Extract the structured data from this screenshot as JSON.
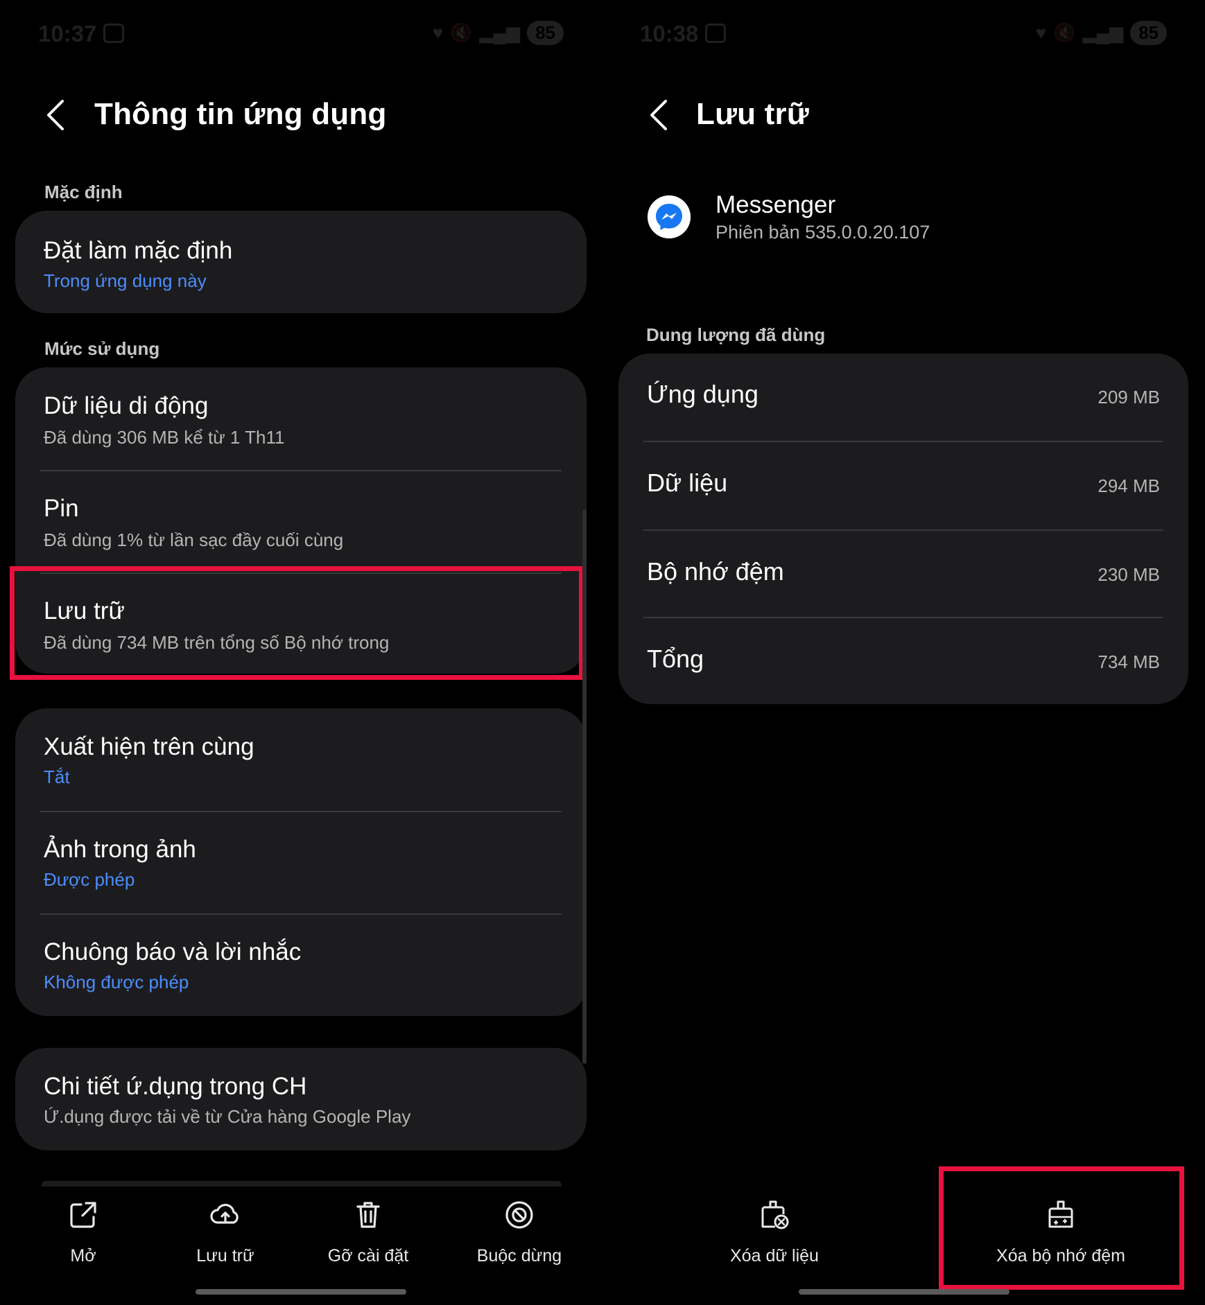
{
  "left_screen": {
    "status_bar": {
      "time": "10:37",
      "battery": "85"
    },
    "title": "Thông tin ứng dụng",
    "sections": [
      {
        "label": "Mặc định",
        "items": [
          {
            "title": "Đặt làm mặc định",
            "subtitle": "Trong ứng dụng này"
          }
        ]
      },
      {
        "label": "Mức sử dụng",
        "items": [
          {
            "title": "Dữ liệu di động",
            "subtitle": "Đã dùng 306 MB kể từ 1 Th11"
          },
          {
            "title": "Pin",
            "subtitle": "Đã dùng 1% từ lần sạc đầy cuối cùng"
          },
          {
            "title": "Lưu trữ",
            "subtitle": "Đã dùng 734 MB trên tổng số Bộ nhớ trong"
          }
        ]
      },
      {
        "label": "",
        "items": [
          {
            "title": "Xuất hiện trên cùng",
            "subtitle": "Tắt"
          },
          {
            "title": "Ảnh trong ảnh",
            "subtitle": "Được phép"
          },
          {
            "title": "Chuông báo và lời nhắc",
            "subtitle": "Không được phép"
          }
        ]
      },
      {
        "label": "",
        "items": [
          {
            "title": "Chi tiết ứ.dụng trong CH",
            "subtitle": "Ứ.dụng được tải về từ Cửa hàng Google Play"
          }
        ]
      }
    ],
    "toolbar": [
      {
        "label": "Mở",
        "icon": "open-external-icon"
      },
      {
        "label": "Lưu trữ",
        "icon": "cloud-upload-icon"
      },
      {
        "label": "Gỡ cài đặt",
        "icon": "trash-icon"
      },
      {
        "label": "Buộc dừng",
        "icon": "stop-icon"
      }
    ]
  },
  "right_screen": {
    "status_bar": {
      "time": "10:38",
      "battery": "85"
    },
    "title": "Lưu trữ",
    "app": {
      "name": "Messenger",
      "version": "Phiên bản 535.0.0.20.107",
      "icon": "messenger-icon"
    },
    "usage_label": "Dung lượng đã dùng",
    "usage_rows": [
      {
        "label": "Ứng dụng",
        "value": "209 MB"
      },
      {
        "label": "Dữ liệu",
        "value": "294 MB"
      },
      {
        "label": "Bộ nhớ đệm",
        "value": "230 MB"
      },
      {
        "label": "Tổng",
        "value": "734 MB"
      }
    ],
    "toolbar": [
      {
        "label": "Xóa dữ liệu",
        "icon": "clear-data-icon"
      },
      {
        "label": "Xóa bộ nhớ đệm",
        "icon": "clear-cache-icon"
      }
    ]
  },
  "colors": {
    "background": "#000000",
    "card": "#1c1c1e",
    "accent_blue": "#4c8dff",
    "highlight_red": "#e8123e",
    "secondary_text": "#b5b5b5"
  }
}
